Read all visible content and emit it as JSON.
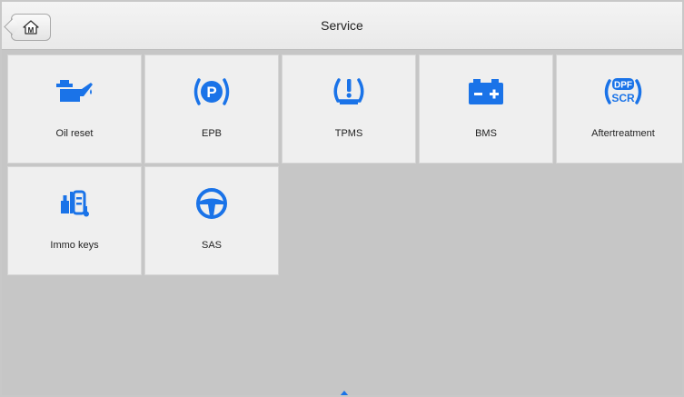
{
  "header": {
    "title": "Service",
    "home_icon": "home-m-icon",
    "home_icon_letter": "M"
  },
  "tiles": [
    {
      "label": "Oil reset",
      "icon": "oil-can-icon"
    },
    {
      "label": "EPB",
      "icon": "parking-brake-icon",
      "icon_text": "P"
    },
    {
      "label": "TPMS",
      "icon": "tire-pressure-icon"
    },
    {
      "label": "BMS",
      "icon": "battery-icon"
    },
    {
      "label": "Aftertreatment",
      "icon": "dpf-scr-icon",
      "icon_text_top": "DPF",
      "icon_text_bottom": "SCR"
    },
    {
      "label": "Immo keys",
      "icon": "immobilizer-key-icon"
    },
    {
      "label": "SAS",
      "icon": "steering-wheel-icon"
    }
  ],
  "colors": {
    "accent": "#1a73e8",
    "background": "#c6c6c6",
    "tile": "#efefef"
  }
}
